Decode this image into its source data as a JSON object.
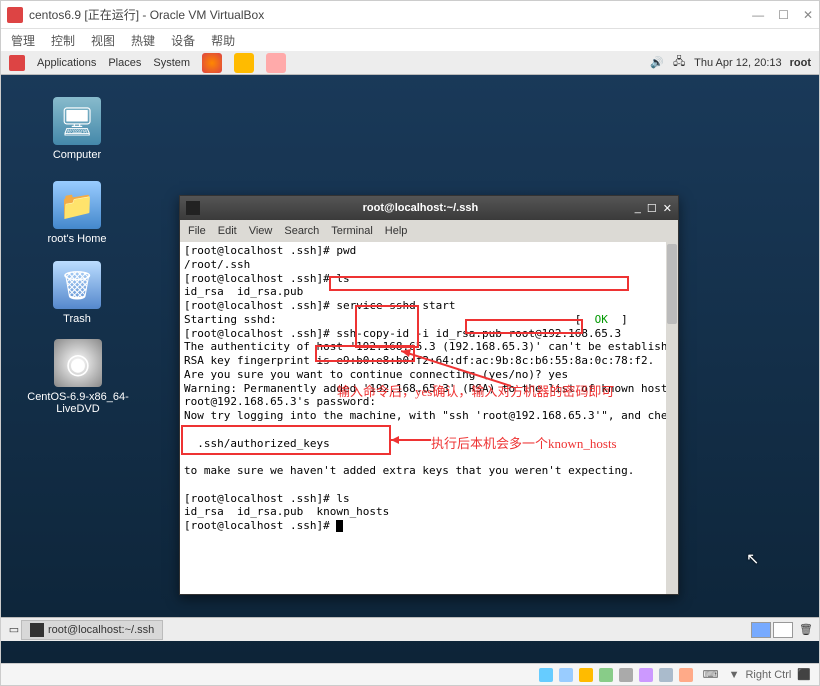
{
  "virtualbox": {
    "title": "centos6.9 [正在运行] - Oracle VM VirtualBox",
    "menu": [
      "管理",
      "控制",
      "视图",
      "热键",
      "设备",
      "帮助"
    ],
    "status_right": "Right Ctrl"
  },
  "gnome_top": {
    "apps": "Applications",
    "places": "Places",
    "system": "System",
    "clock": "Thu Apr 12, 20:13",
    "user": "root"
  },
  "desktop_icons": [
    {
      "label": "Computer"
    },
    {
      "label": "root's Home"
    },
    {
      "label": "Trash"
    },
    {
      "label": "CentOS-6.9-x86_64-LiveDVD"
    }
  ],
  "terminal": {
    "title": "root@localhost:~/.ssh",
    "menu": [
      "File",
      "Edit",
      "View",
      "Search",
      "Terminal",
      "Help"
    ],
    "lines": [
      "[root@localhost .ssh]# pwd",
      "/root/.ssh",
      "[root@localhost .ssh]# ls",
      "id_rsa  id_rsa.pub",
      "[root@localhost .ssh]# service sshd start",
      "Starting sshd:                                             [  OK  ]",
      "[root@localhost .ssh]# ssh-copy-id -i id_rsa.pub root@192.168.65.3",
      "The authenticity of host '192.168.65.3 (192.168.65.3)' can't be established.",
      "RSA key fingerprint is e9:b0:e8:b0:f2:64:df:ac:9b:8c:b6:55:8a:0c:78:f2.",
      "Are you sure you want to continue connecting (yes/no)? yes",
      "Warning: Permanently added '192.168.65.3' (RSA) to the list of known hosts.",
      "root@192.168.65.3's password:",
      "Now try logging into the machine, with \"ssh 'root@192.168.65.3'\", and check in:",
      "",
      "  .ssh/authorized_keys",
      "",
      "to make sure we haven't added extra keys that you weren't expecting.",
      "",
      "[root@localhost .ssh]# ls",
      "id_rsa  id_rsa.pub  known_hosts",
      "[root@localhost .ssh]# "
    ]
  },
  "annotations": {
    "note1": "输入命令后，yes确认，输入对方机器的密码即可",
    "note2": "执行后本机会多一个known_hosts"
  },
  "gnome_bottom": {
    "task": "root@localhost:~/.ssh"
  }
}
